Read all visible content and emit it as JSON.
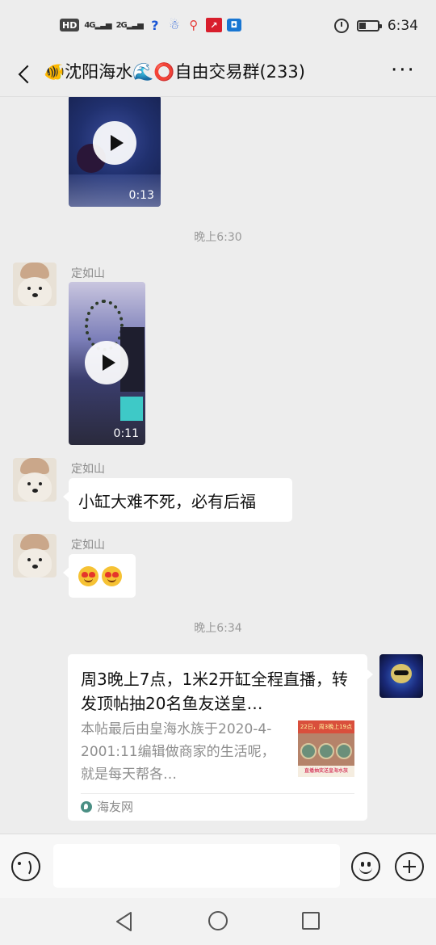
{
  "status_bar": {
    "network_badge": "HD",
    "signal1": "4G",
    "signal2": "2G",
    "time": "6:34"
  },
  "header": {
    "title": "🐠沈阳海水🌊⭕自由交易群(233)",
    "more_label": "···"
  },
  "messages": {
    "video1": {
      "duration": "0:13"
    },
    "timestamp1": "晚上6:30",
    "video2": {
      "sender": "定如山",
      "duration": "0:11"
    },
    "text1": {
      "sender": "定如山",
      "text": "小缸大难不死，必有后福"
    },
    "emoji1": {
      "sender": "定如山",
      "emoji_names": [
        "heart-eyes",
        "heart-eyes"
      ]
    },
    "timestamp2": "晚上6:34",
    "link_card": {
      "title": "周3晚上7点，1米2开缸全程直播，转发顶帖抽20名鱼友送皇…",
      "description": "本帖最后由皇海水族于2020-4-2001:11编辑做商家的生活呢，就是每天帮各…",
      "thumb_top_text": "22日，周3晚上19点",
      "thumb_bottom_text": "直播抽奖送皇海水族",
      "source": "海友网"
    }
  },
  "input": {
    "placeholder": ""
  },
  "colors": {
    "background": "#ededed",
    "bubble": "#ffffff",
    "timestamp": "#9a9a9a"
  }
}
